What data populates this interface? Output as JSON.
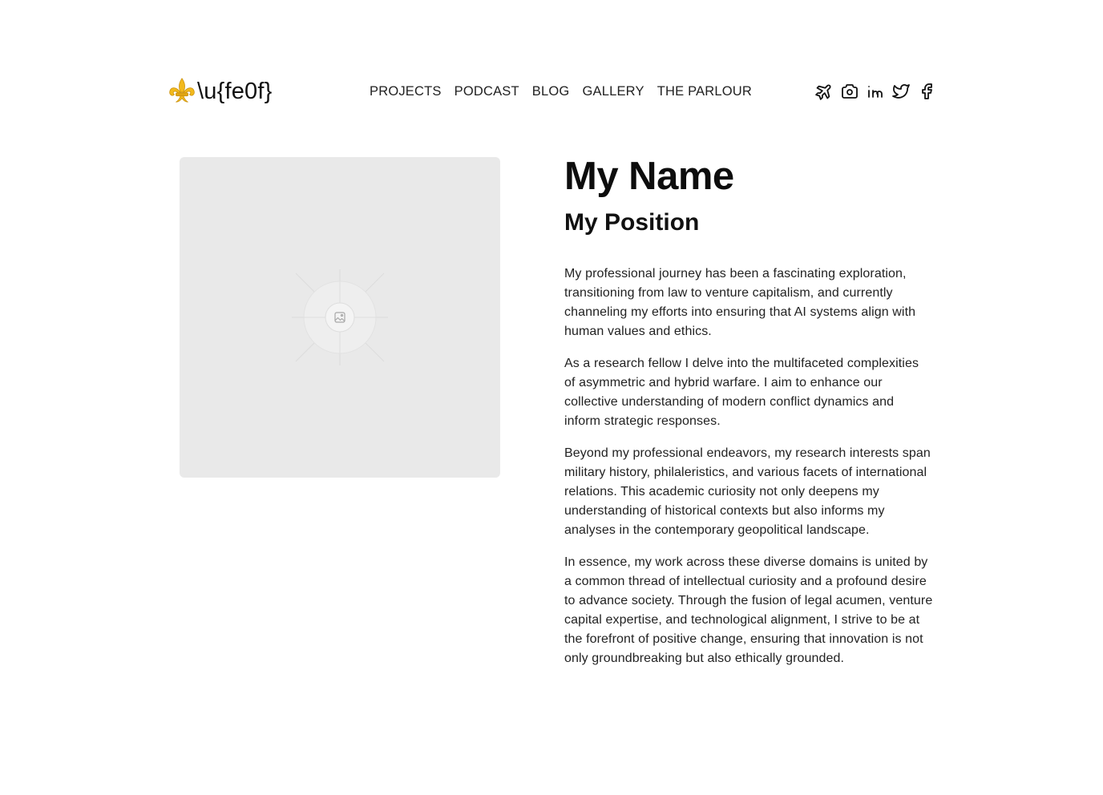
{
  "header": {
    "logo_text": "\\u{fe0f}",
    "logo_icon": "fleur-de-lis-icon",
    "nav": [
      {
        "label": "PROJECTS"
      },
      {
        "label": "PODCAST"
      },
      {
        "label": "BLOG"
      },
      {
        "label": "GALLERY"
      },
      {
        "label": "THE PARLOUR"
      }
    ],
    "social": [
      {
        "icon": "plane-icon"
      },
      {
        "icon": "camera-icon"
      },
      {
        "icon": "linkedin-icon"
      },
      {
        "icon": "twitter-icon"
      },
      {
        "icon": "facebook-icon"
      }
    ]
  },
  "profile": {
    "image_icon": "image-placeholder-icon",
    "name": "My Name",
    "position": "My Position",
    "bio": [
      "My professional journey has been a fascinating exploration, transitioning from law to venture capitalism, and currently channeling my efforts into ensuring that AI systems align with human values and ethics.",
      "As a research fellow I delve into the multifaceted complexities of asymmetric and hybrid warfare. I aim to enhance our collective understanding of modern conflict dynamics and inform strategic responses.",
      "Beyond my professional endeavors, my research interests span military history, philaleristics, and various facets of international relations. This academic curiosity not only deepens my understanding of historical contexts but also informs my analyses in the contemporary geopolitical landscape.",
      "In essence, my work across these diverse domains is united by a common thread of intellectual curiosity and a profound desire to advance society. Through the fusion of legal acumen, venture capital expertise, and technological alignment, I strive to be at the forefront of positive change, ensuring that innovation is not only groundbreaking but also ethically grounded."
    ]
  },
  "colors": {
    "background": "#ffffff",
    "text": "#111111",
    "placeholder": "#e9e9e9",
    "logo_gold": "#f2b91c"
  }
}
